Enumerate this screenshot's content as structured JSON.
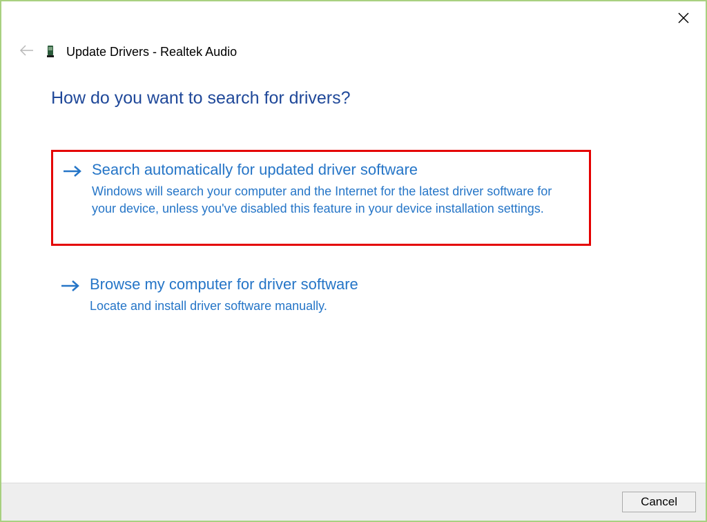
{
  "window": {
    "title": "Update Drivers - Realtek Audio"
  },
  "heading": "How do you want to search for drivers?",
  "options": [
    {
      "title": "Search automatically for updated driver software",
      "description": "Windows will search your computer and the Internet for the latest driver software for your device, unless you've disabled this feature in your device installation settings."
    },
    {
      "title": "Browse my computer for driver software",
      "description": "Locate and install driver software manually."
    }
  ],
  "footer": {
    "cancel_label": "Cancel"
  }
}
